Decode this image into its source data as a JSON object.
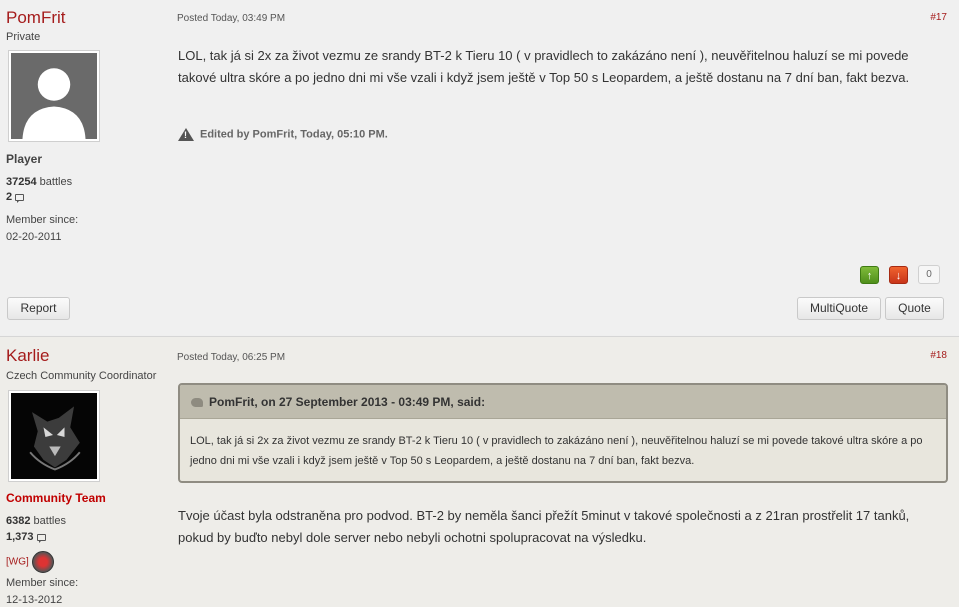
{
  "posts": [
    {
      "author": {
        "name": "PomFrit",
        "title": "Private",
        "rank": "Player",
        "battles_value": "37254",
        "battles_label": "battles",
        "comments": "2",
        "member_since_label": "Member since:",
        "member_since": "02-20-2011"
      },
      "posted": "Posted Today, 03:49 PM",
      "number": "#17",
      "body": "LOL, tak já si 2x za život vezmu ze srandy BT-2 k Tieru 10 ( v pravidlech to zakázáno není ), neuvěřitelnou haluzí se mi povede takové ultra skóre a po jedno dni mi vše vzali i když jsem ještě v Top 50 s Leopardem, a ještě dostanu na 7 dní ban, fakt bezva.",
      "edited": "Edited by PomFrit, Today, 05:10 PM.",
      "vote_up": "↑",
      "vote_down": "↓",
      "vote_count": "0",
      "report_label": "Report",
      "multiquote_label": "MultiQuote",
      "quote_label": "Quote"
    },
    {
      "author": {
        "name": "Karlie",
        "title": "Czech Community Coordinator",
        "rank": "Community Team",
        "battles_value": "6382",
        "battles_label": "battles",
        "comments": "1,373",
        "clan_tag": "[WG]",
        "member_since_label": "Member since:",
        "member_since": "12-13-2012"
      },
      "posted": "Posted Today, 06:25 PM",
      "number": "#18",
      "quote_header": "PomFrit, on 27 September 2013 - 03:49 PM, said:",
      "quote_body": "LOL, tak já si 2x za život vezmu ze srandy BT-2 k Tieru 10 ( v pravidlech to zakázáno není ), neuvěřitelnou haluzí se mi povede takové ultra skóre a po jedno dni mi vše vzali i když jsem ještě v Top 50 s Leopardem, a ještě dostanu na 7 dní ban, fakt bezva.",
      "body": "Tvoje účast byla odstraněna pro podvod. BT-2 by neměla šanci přežít 5minut v takové společnosti a z 21ran prostřelit 17 tanků, pokud by buďto nebyl dole server nebo nebyli ochotni spolupracovat na výsledku."
    }
  ],
  "colors": {
    "author_name": "#a51c1c",
    "rank_community": "#c00000",
    "vote_up": "#5a9c22",
    "vote_down": "#d8421f"
  }
}
